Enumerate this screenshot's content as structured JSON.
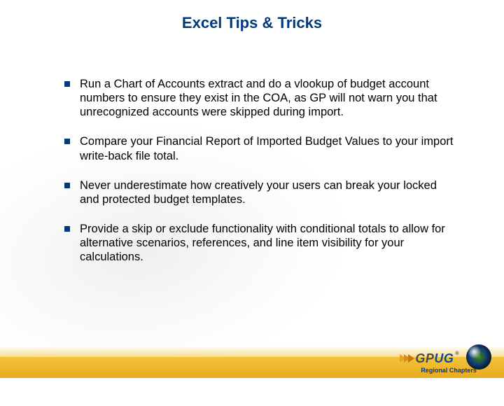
{
  "title": "Excel Tips & Tricks",
  "bullets": [
    "Run a Chart of Accounts extract and do a vlookup of budget account numbers to ensure they exist in the COA, as GP will not warn you that unrecognized accounts were skipped during import.",
    "Compare your Financial Report of Imported Budget Values to your import write-back file total.",
    "Never underestimate how creatively your users can break your locked and protected budget templates.",
    "Provide a skip or exclude functionality with conditional totals to allow for alternative scenarios, references, and line item visibility for your calculations."
  ],
  "footer": {
    "logo_gp": "GP",
    "logo_ug": "UG",
    "registered": "®",
    "caption": "Regional Chapters"
  }
}
